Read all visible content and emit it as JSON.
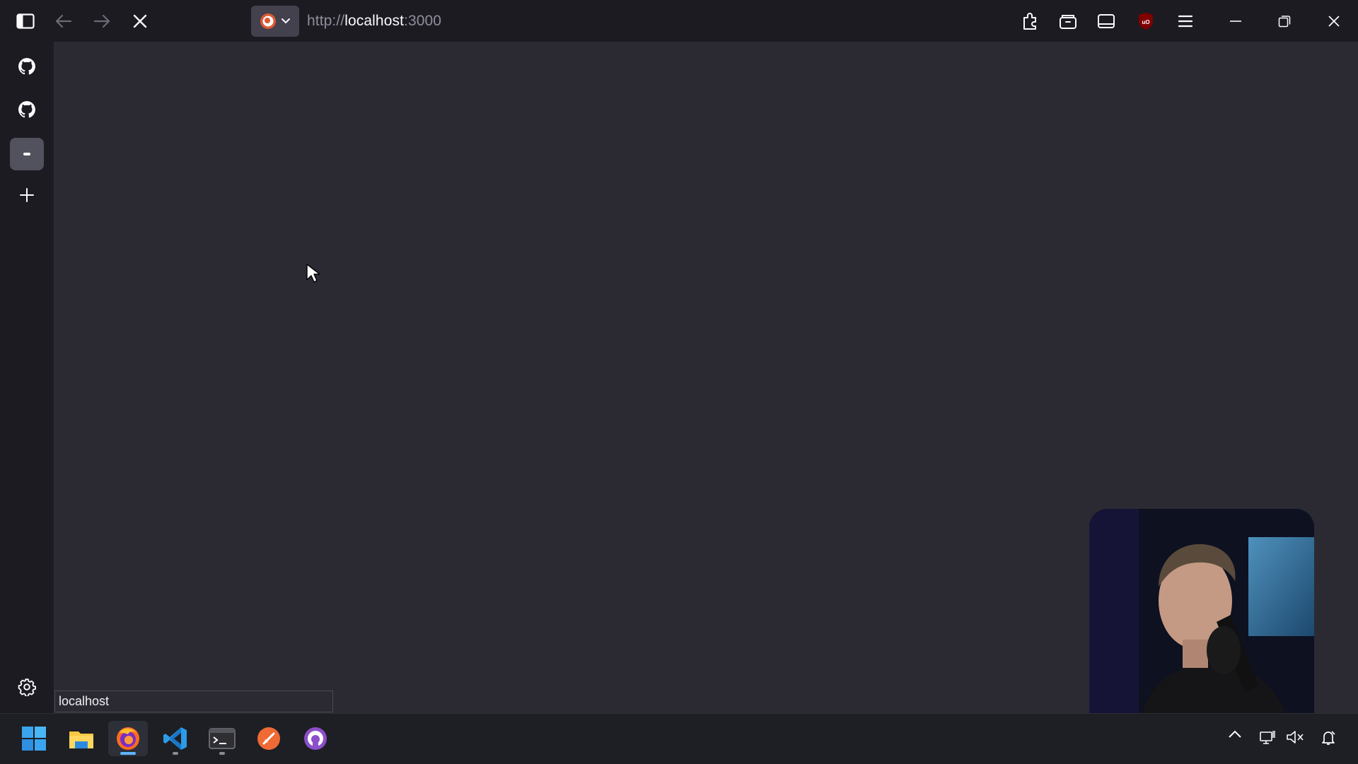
{
  "browser": {
    "url_scheme": "http://",
    "url_host": "localhost",
    "url_port": ":3000",
    "status_text": "localhost",
    "accent": "#fbfbfe"
  },
  "toolbar": {
    "left_icons": [
      "sidebar-toggle-icon",
      "back-arrow-icon",
      "forward-arrow-icon",
      "stop-loading-icon"
    ],
    "right_icons": [
      "extensions-icon",
      "container-tabs-icon",
      "tab-view-icon",
      "ublock-origin-icon",
      "hamburger-menu-icon",
      "minimize-icon",
      "restore-icon",
      "close-icon"
    ]
  },
  "sidebar": {
    "items": [
      {
        "icon": "github-icon"
      },
      {
        "icon": "github-icon"
      },
      {
        "icon": "app-icon",
        "active": true
      },
      {
        "icon": "plus-icon"
      }
    ],
    "bottom_icon": "settings-gear-icon"
  },
  "taskbar": {
    "apps": [
      "windows-start-icon",
      "file-explorer-icon",
      "firefox-icon",
      "vscode-icon",
      "terminal-icon",
      "orange-app-icon",
      "github-desktop-icon"
    ],
    "tray": [
      "chevron-up-icon",
      "network-icon",
      "volume-muted-icon",
      "notification-icon"
    ]
  },
  "overlay": {
    "webcam": "webcam-presenter"
  }
}
